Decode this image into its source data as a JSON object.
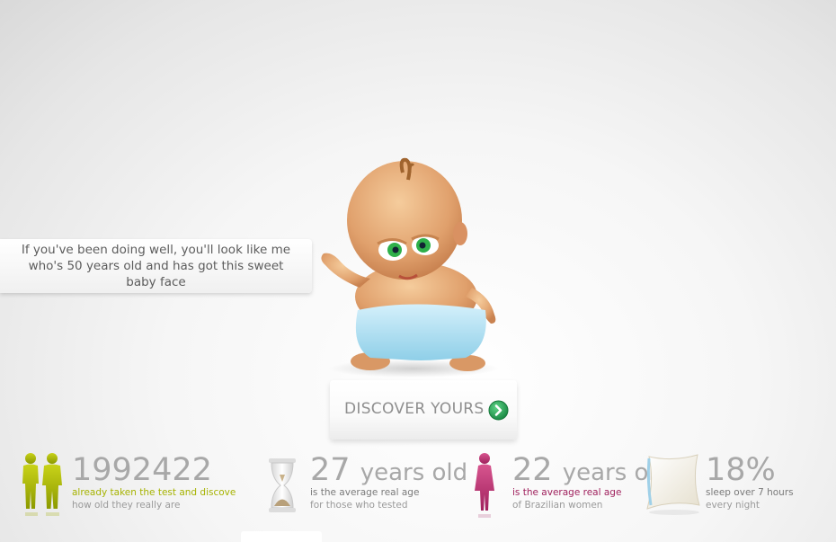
{
  "intro": {
    "caption": "If you've been doing well, you'll look like me who's 50 years old and has got this sweet baby face"
  },
  "cta": {
    "label": "DISCOVER YOURS",
    "icon": "arrow-right-circle-icon"
  },
  "stats": [
    {
      "icon": "people-icon",
      "number": "1992422",
      "unit": "",
      "line1": "already taken the test and discovered",
      "line2": "how old they really are",
      "line1_color": "#a6b300"
    },
    {
      "icon": "hourglass-icon",
      "number": "27",
      "unit": "years old",
      "line1": "is the average real age",
      "line2": "for those who tested",
      "line1_color": "#7a7a7a"
    },
    {
      "icon": "woman-icon",
      "number": "22",
      "unit": "years old",
      "line1": "is the average real age",
      "line2": "of Brazilian women",
      "line1_color": "#a0225e"
    },
    {
      "icon": "pillow-icon",
      "number": "18%",
      "unit": "",
      "line1": "sleep over 7 hours",
      "line2": "every night",
      "line1_color": "#7a7a7a"
    }
  ]
}
